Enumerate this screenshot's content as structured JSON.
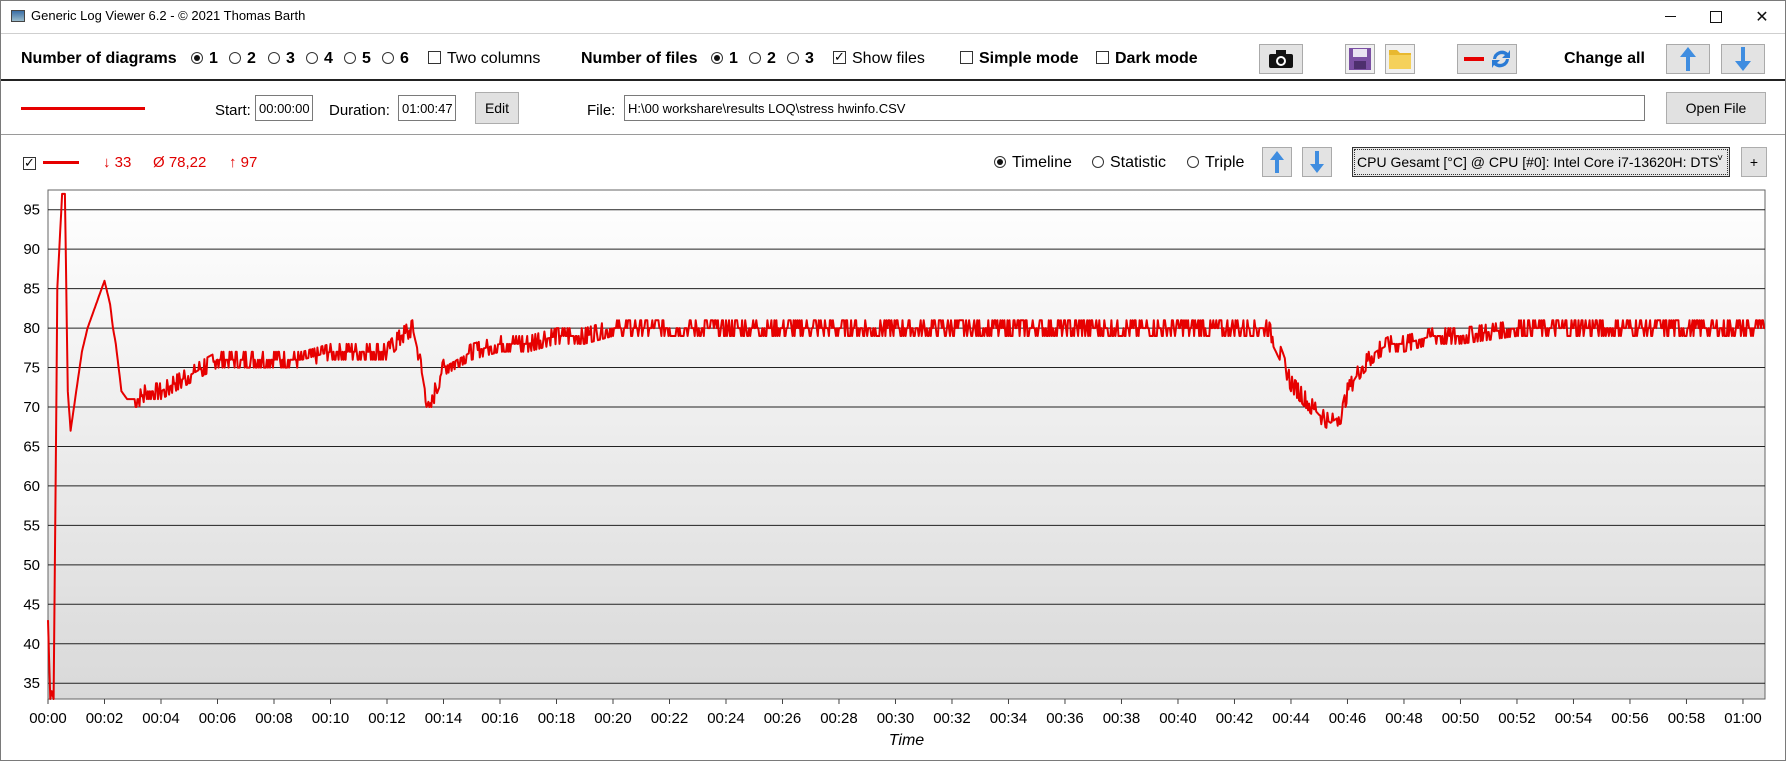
{
  "window": {
    "title": "Generic Log Viewer 6.2 - © 2021 Thomas Barth"
  },
  "toolbar": {
    "num_diagrams_label": "Number of diagrams",
    "diagram_options": [
      "1",
      "2",
      "3",
      "4",
      "5",
      "6"
    ],
    "diagram_selected": "1",
    "two_columns_label": "Two columns",
    "two_columns_checked": false,
    "num_files_label": "Number of files",
    "file_options": [
      "1",
      "2",
      "3"
    ],
    "file_selected": "1",
    "show_files_label": "Show files",
    "show_files_checked": true,
    "simple_mode_label": "Simple mode",
    "simple_mode_checked": false,
    "dark_mode_label": "Dark mode",
    "dark_mode_checked": false,
    "change_all_label": "Change all",
    "icons": [
      "camera-icon",
      "save-icon",
      "folder-icon",
      "line-refresh-icon",
      "arrow-up-icon",
      "arrow-down-icon"
    ]
  },
  "file": {
    "start_label": "Start:",
    "start_value": "00:00:00",
    "duration_label": "Duration:",
    "duration_value": "01:00:47",
    "edit_label": "Edit",
    "file_label": "File:",
    "file_path": "H:\\00 workshare\\results LOQ\\stress hwinfo.CSV",
    "open_file_label": "Open File",
    "line_color": "#e60000"
  },
  "diagram": {
    "min_text": "↓ 33",
    "avg_text": "Ø 78,22",
    "max_text": "↑ 97",
    "view_options": [
      "Timeline",
      "Statistic",
      "Triple"
    ],
    "view_selected": "Timeline",
    "sensor": "CPU Gesamt [°C] @ CPU [#0]: Intel Core i7-13620H: DTS",
    "add_label": "+"
  },
  "chart_data": {
    "type": "line",
    "title": "",
    "xlabel": "Time",
    "ylabel": "",
    "ylim": [
      33,
      97.5
    ],
    "xlim_minutes": [
      0,
      60.78
    ],
    "y_ticks": [
      35,
      40,
      45,
      50,
      55,
      60,
      65,
      70,
      75,
      80,
      85,
      90,
      95
    ],
    "x_ticks": [
      "00:00",
      "00:02",
      "00:04",
      "00:06",
      "00:08",
      "00:10",
      "00:12",
      "00:14",
      "00:16",
      "00:18",
      "00:20",
      "00:22",
      "00:24",
      "00:26",
      "00:28",
      "00:30",
      "00:32",
      "00:34",
      "00:36",
      "00:38",
      "00:40",
      "00:42",
      "00:44",
      "00:46",
      "00:48",
      "00:50",
      "00:52",
      "00:54",
      "00:56",
      "00:58",
      "01:00"
    ],
    "grid": true,
    "series": [
      {
        "color": "#e60000",
        "x_minutes": [
          0,
          0.08,
          0.13,
          0.2,
          0.27,
          0.33,
          0.4,
          0.5,
          0.6,
          0.7,
          0.8,
          1.0,
          1.2,
          1.4,
          1.6,
          1.8,
          2.0,
          2.2,
          2.3,
          2.4,
          2.6,
          2.8,
          3.0,
          3.2,
          3.5,
          4.0,
          4.5,
          5.0,
          5.5,
          6.0,
          7.0,
          8.0,
          9.0,
          10.0,
          11.0,
          12.0,
          12.5,
          12.9,
          13.1,
          13.3,
          13.5,
          13.7,
          14.0,
          14.5,
          15.0,
          16.0,
          17.0,
          18.0,
          19.0,
          20.0,
          22.0,
          24.0,
          26.0,
          28.0,
          30.0,
          32.0,
          34.0,
          36.0,
          38.0,
          40.0,
          42.0,
          43.2,
          43.6,
          44.0,
          44.5,
          45.0,
          45.4,
          45.8,
          46.0,
          46.5,
          47.0,
          47.5,
          48.0,
          49.0,
          50.0,
          52.0,
          54.0,
          56.0,
          58.0,
          60.0,
          60.78
        ],
        "values": [
          43,
          33,
          34,
          33,
          60,
          85,
          90,
          97,
          97,
          72,
          67,
          72,
          77,
          80,
          82,
          84,
          86,
          83,
          80,
          78,
          72,
          71,
          71,
          71,
          72,
          72,
          73,
          74,
          75,
          76,
          76,
          76,
          76,
          77,
          77,
          77,
          79,
          80,
          77,
          73,
          69,
          72,
          75,
          76,
          77,
          78,
          78,
          79,
          79,
          80,
          80,
          80,
          80,
          80,
          80,
          80,
          80,
          80,
          80,
          80,
          80,
          80,
          77,
          73,
          71,
          69,
          68,
          69,
          72,
          75,
          77,
          78,
          78,
          79,
          79,
          80,
          80,
          80,
          80,
          80,
          80
        ]
      }
    ]
  }
}
